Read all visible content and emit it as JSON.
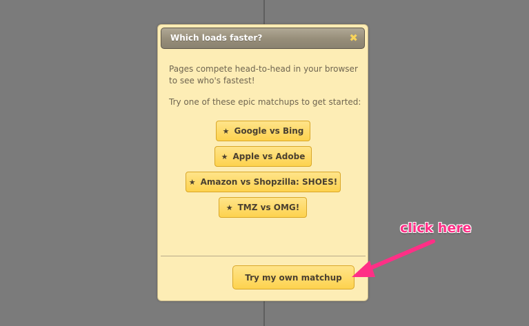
{
  "dialog": {
    "title": "Which loads faster?",
    "close_glyph": "✖",
    "intro": "Pages compete head-to-head in your browser to see who's fastest!",
    "prompt": "Try one of these epic matchups to get started:",
    "matchups": [
      {
        "label": "Google vs Bing"
      },
      {
        "label": "Apple vs Adobe"
      },
      {
        "label": "Amazon vs Shopzilla: SHOES!"
      },
      {
        "label": "TMZ vs OMG!"
      }
    ],
    "star_glyph": "★",
    "own_matchup_label": "Try my own matchup"
  },
  "annotation": {
    "text": "click here",
    "color": "#ff2f86"
  },
  "colors": {
    "background": "#7b7b7b",
    "dialog_bg": "#fdedb5",
    "button_bg": "#fdd24e",
    "title_bar": "#968d79"
  }
}
